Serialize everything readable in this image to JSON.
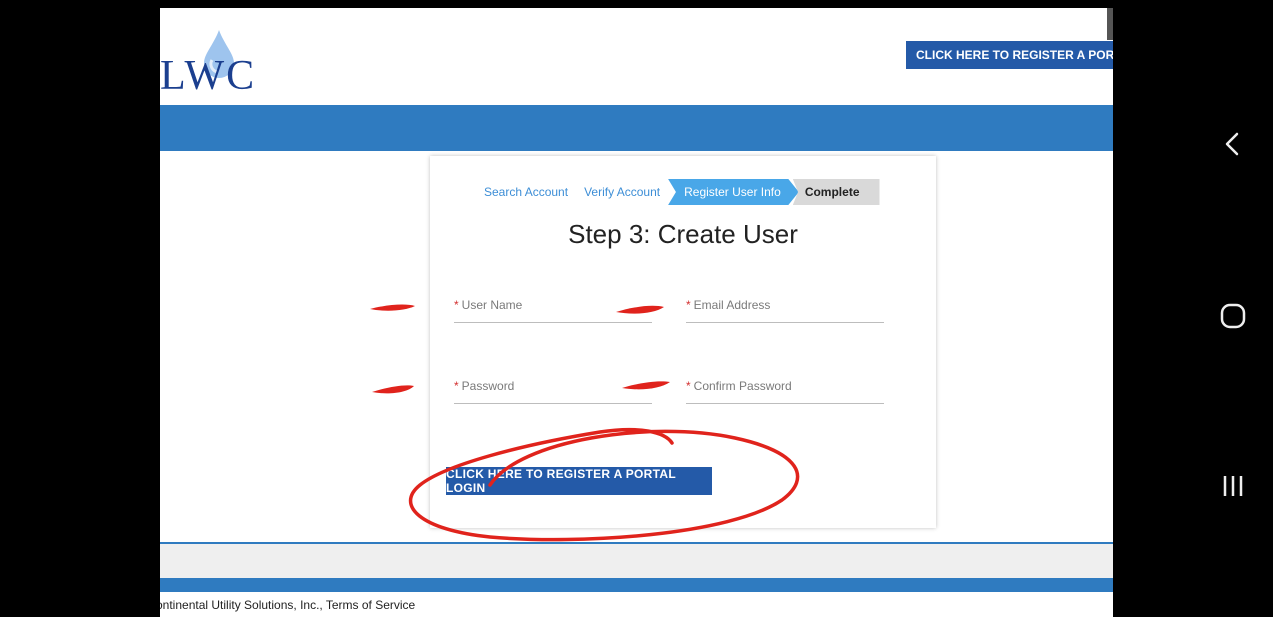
{
  "logo": {
    "text": "LWC"
  },
  "header": {
    "register_button_label": "CLICK HERE TO REGISTER A PORTAL LOGIN"
  },
  "wizard": {
    "steps": [
      {
        "label": "Search Account"
      },
      {
        "label": "Verify Account"
      },
      {
        "label": "Register User Info"
      },
      {
        "label": "Complete"
      }
    ],
    "title": "Step 3: Create User"
  },
  "form": {
    "user_name_label": "User Name",
    "email_label": "Email Address",
    "password_label": "Password",
    "confirm_password_label": "Confirm Password",
    "required_marker": "*",
    "submit_label": "CLICK HERE TO REGISTER A PORTAL LOGIN"
  },
  "footer": {
    "text": "ontinental Utility Solutions, Inc.,   Terms of Service"
  },
  "colors": {
    "brand_blue": "#2f7bc0",
    "button_blue": "#245aa8",
    "active_step": "#49a7e8",
    "annotation_red": "#e0231c"
  },
  "android_nav": {
    "icons": [
      "back-icon",
      "home-icon",
      "recent-apps-icon"
    ]
  }
}
